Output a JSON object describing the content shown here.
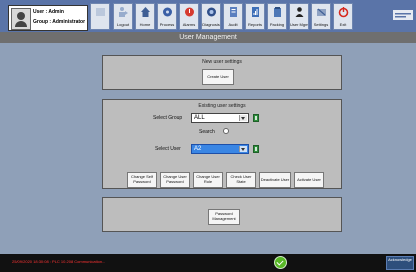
{
  "user_box": {
    "user_label": "User : Admin",
    "group_label": "Group : Administrator"
  },
  "toolbar": [
    {
      "name": "blank",
      "label": ""
    },
    {
      "name": "logout",
      "label": "Logout"
    },
    {
      "name": "home",
      "label": "Home"
    },
    {
      "name": "process",
      "label": "Process"
    },
    {
      "name": "alarms",
      "label": "Alarms"
    },
    {
      "name": "diagnosis",
      "label": "Diagnosis"
    },
    {
      "name": "audit",
      "label": "Audit"
    },
    {
      "name": "reports",
      "label": "Reports"
    },
    {
      "name": "packing",
      "label": "Packing"
    },
    {
      "name": "user-mgmt",
      "label": "User Mgmt"
    },
    {
      "name": "settings",
      "label": "Settings"
    },
    {
      "name": "exit",
      "label": "Exit"
    }
  ],
  "page_title": "User Management",
  "new_user": {
    "title": "New user settings",
    "create_button": "Create User"
  },
  "existing_user": {
    "title": "Existing user settings",
    "group_label": "Select Group",
    "group_value": "ALL",
    "search_label": "Search",
    "user_label": "Select User",
    "user_value": "A2",
    "buttons": [
      "Change Self Password",
      "Change User Password",
      "Change User Role",
      "Check User State",
      "Deactivate User",
      "Activate User"
    ]
  },
  "password_panel": {
    "button": "Password Management"
  },
  "status_bar": {
    "message": "25/09/2020 18:30:08 : PLC 10.208 Communication...",
    "right_label": "Acknowledge"
  },
  "colors": {
    "background": "#8fa0b8",
    "topbar": "#5a74a8",
    "title_bar": "#6f6f6f",
    "panel": "#bdbdbd",
    "selected_field": "#3a86e4",
    "status_ok": "#58b826",
    "status_text": "#ff3333"
  }
}
